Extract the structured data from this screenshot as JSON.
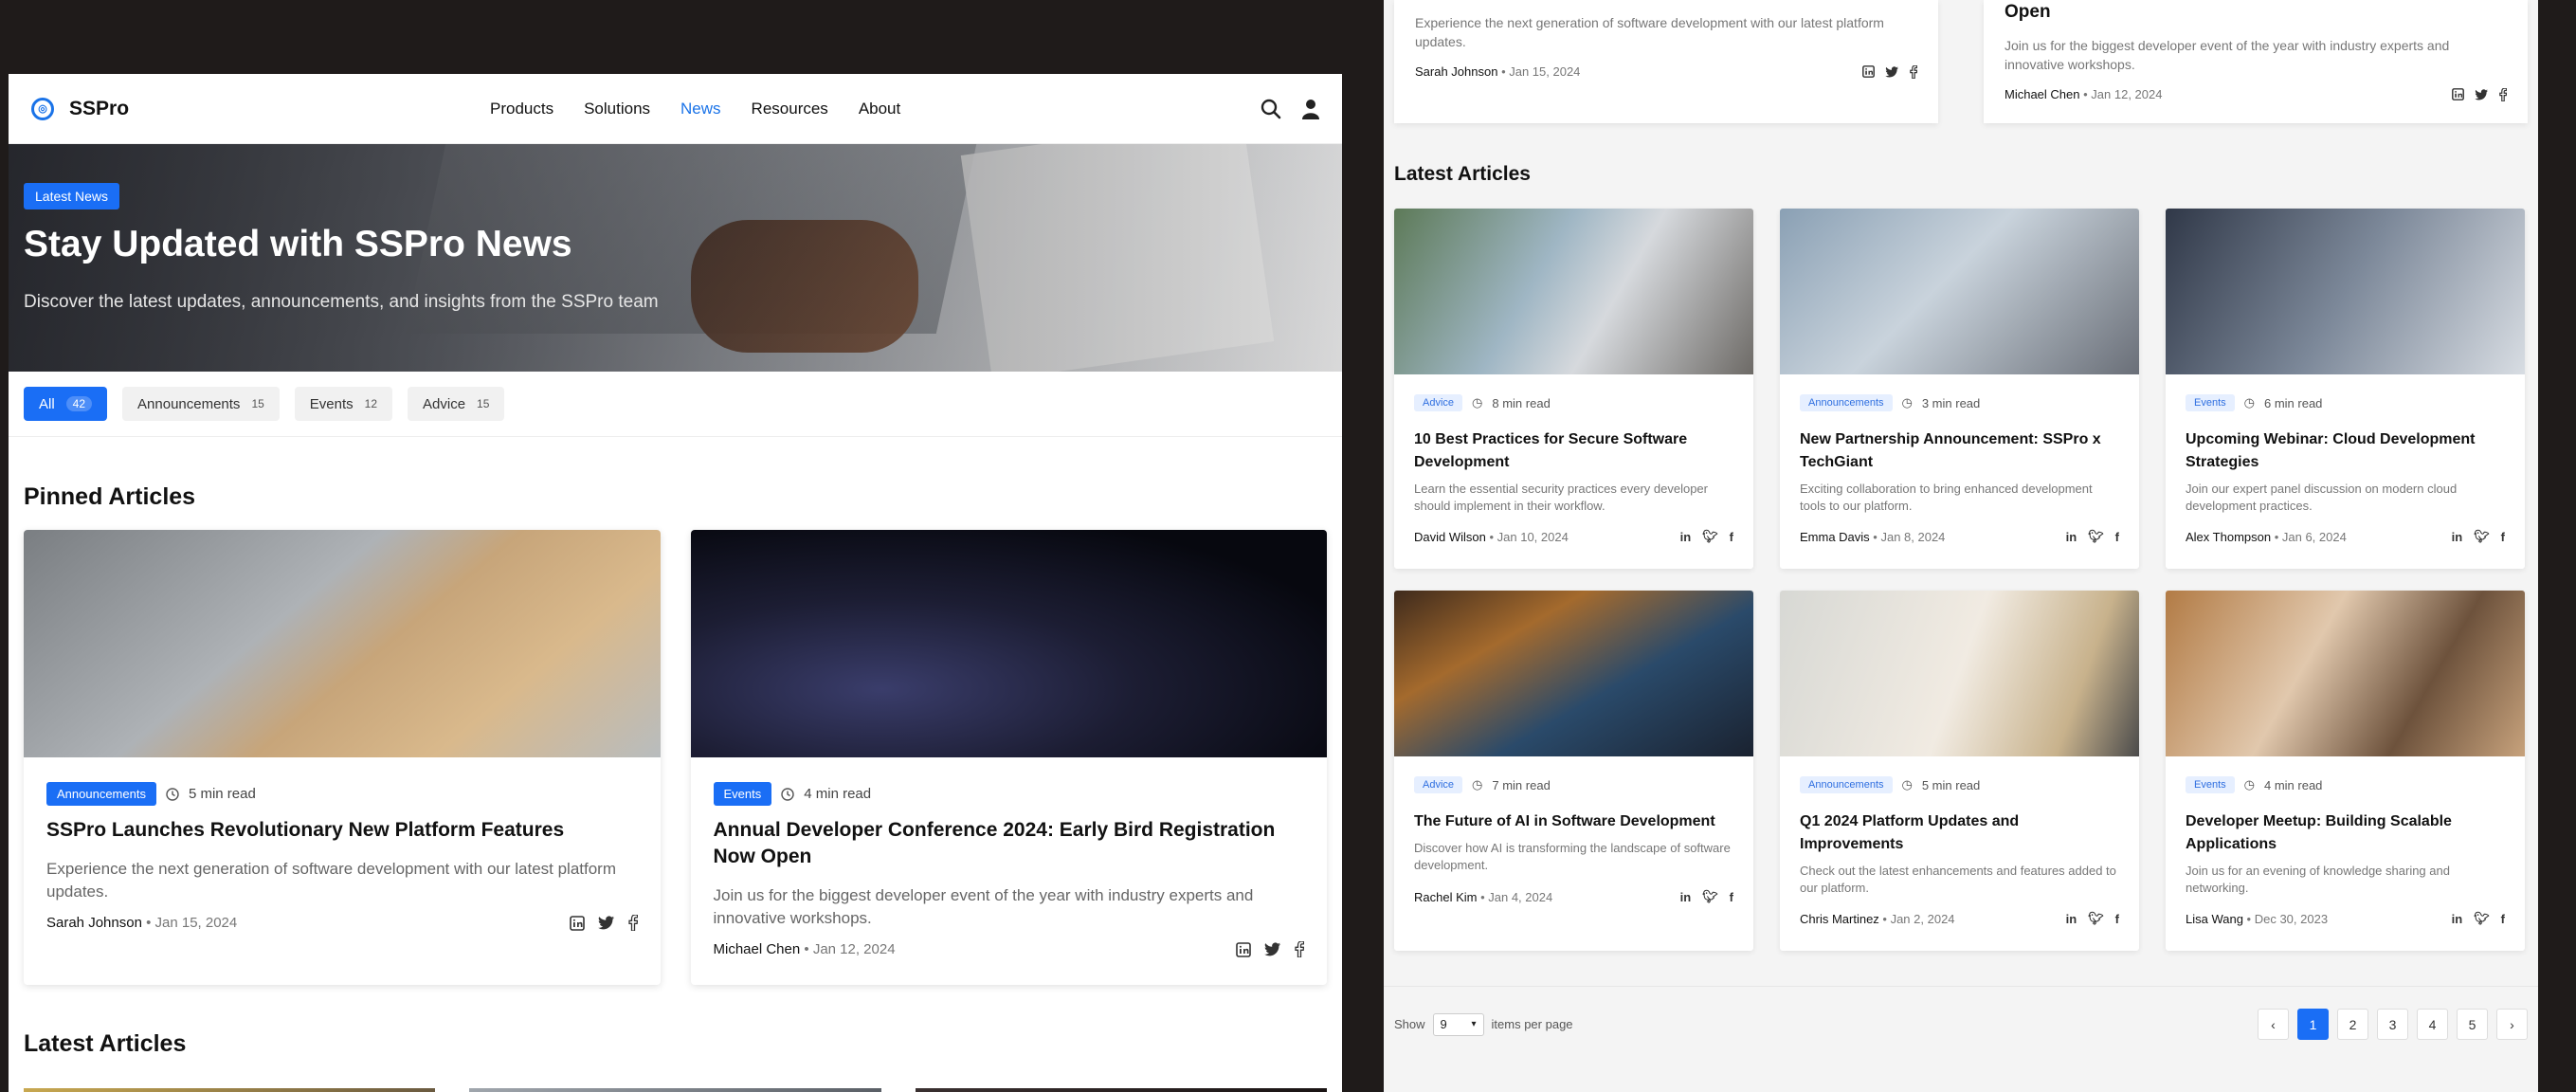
{
  "brand": {
    "name": "SSPro"
  },
  "nav": [
    "Products",
    "Solutions",
    "News",
    "Resources",
    "About"
  ],
  "hero": {
    "badge": "Latest News",
    "title": "Stay Updated with SSPro News",
    "subtitle": "Discover the latest updates, announcements, and insights from the SSPro team"
  },
  "filters": [
    {
      "label": "All",
      "count": "42"
    },
    {
      "label": "Announcements",
      "count": "15"
    },
    {
      "label": "Events",
      "count": "12"
    },
    {
      "label": "Advice",
      "count": "15"
    }
  ],
  "sections": {
    "pinned": "Pinned Articles",
    "latest": "Latest Articles"
  },
  "pinned": [
    {
      "category": "Announcements",
      "read_time": "5 min read",
      "title": "SSPro Launches Revolutionary New Platform Features",
      "description": "Experience the next generation of software development with our latest platform updates.",
      "author": "Sarah Johnson",
      "date": "Jan 15, 2024"
    },
    {
      "category": "Events",
      "read_time": "4 min read",
      "title": "Annual Developer Conference 2024: Early Bird Registration Now Open",
      "description": "Join us for the biggest developer event of the year with industry experts and innovative workshops.",
      "author": "Michael Chen",
      "date": "Jan 12, 2024"
    }
  ],
  "right_top": {
    "left": {
      "description": "Experience the next generation of software development with our latest platform updates.",
      "author": "Sarah Johnson",
      "date": "Jan 15, 2024"
    },
    "right": {
      "title_tail": "Open",
      "description": "Join us for the biggest developer event of the year with industry experts and innovative workshops.",
      "author": "Michael Chen",
      "date": "Jan 12, 2024"
    }
  },
  "articles": [
    {
      "category": "Advice",
      "read_time": "8 min read",
      "title": "10 Best Practices for Secure Software Development",
      "description": "Learn the essential security practices every developer should implement in their workflow.",
      "author": "David Wilson",
      "date": "Jan 10, 2024"
    },
    {
      "category": "Announcements",
      "read_time": "3 min read",
      "title": "New Partnership Announcement: SSPro x TechGiant",
      "description": "Exciting collaboration to bring enhanced development tools to our platform.",
      "author": "Emma Davis",
      "date": "Jan 8, 2024"
    },
    {
      "category": "Events",
      "read_time": "6 min read",
      "title": "Upcoming Webinar: Cloud Development Strategies",
      "description": "Join our expert panel discussion on modern cloud development practices.",
      "author": "Alex Thompson",
      "date": "Jan 6, 2024"
    },
    {
      "category": "Advice",
      "read_time": "7 min read",
      "title": "The Future of AI in Software Development",
      "description": "Discover how AI is transforming the landscape of software development.",
      "author": "Rachel Kim",
      "date": "Jan 4, 2024"
    },
    {
      "category": "Announcements",
      "read_time": "5 min read",
      "title": "Q1 2024 Platform Updates and Improvements",
      "description": "Check out the latest enhancements and features added to our platform.",
      "author": "Chris Martinez",
      "date": "Jan 2, 2024"
    },
    {
      "category": "Events",
      "read_time": "4 min read",
      "title": "Developer Meetup: Building Scalable Applications",
      "description": "Join us for an evening of knowledge sharing and networking.",
      "author": "Lisa Wang",
      "date": "Dec 30, 2023"
    }
  ],
  "pagination": {
    "show_label": "Show",
    "per_page": "9",
    "items_label": "items per page",
    "pages": [
      "1",
      "2",
      "3",
      "4",
      "5"
    ],
    "current": "1",
    "prev": "‹",
    "next": "›"
  },
  "colors": {
    "accent": "#1a6ef5",
    "tag_bg": "#e6efff",
    "backdrop": "#1f1b1a"
  },
  "icons": [
    "logo-icon",
    "search-icon",
    "user-icon",
    "clock-icon",
    "linkedin-icon",
    "twitter-icon",
    "facebook-icon",
    "chevron-down-icon"
  ]
}
